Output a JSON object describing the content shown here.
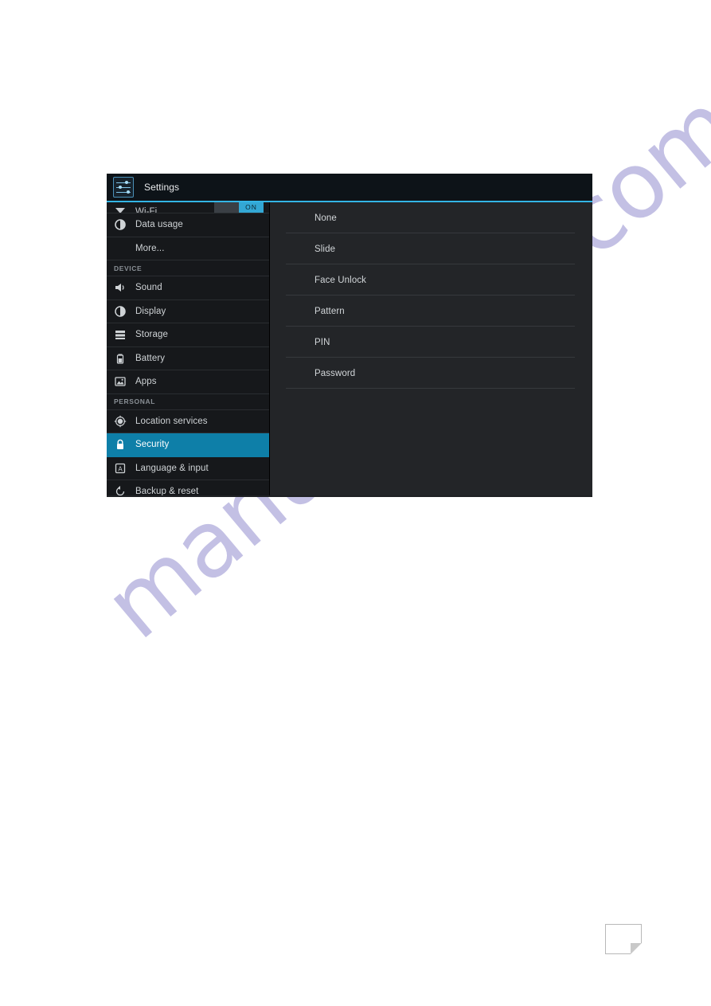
{
  "page": {
    "watermark": "manualshive.com",
    "curl_icon": "page-curl-icon"
  },
  "screenshot": {
    "actionbar": {
      "app_icon": "settings-icon",
      "title": "Settings"
    },
    "accent_color": "#33b5e5",
    "selected_color": "#0e7fa8",
    "sidebar": {
      "wifi": {
        "label": "Wi-Fi",
        "icon": "wifi-icon",
        "toggle_on_label": "ON",
        "toggle_state": "on"
      },
      "top_items": [
        {
          "label": "Data usage",
          "icon": "data-usage-icon",
          "has_icon": true
        },
        {
          "label": "More...",
          "icon": "",
          "has_icon": false
        }
      ],
      "sections": [
        {
          "header": "DEVICE",
          "items": [
            {
              "label": "Sound",
              "icon": "sound-icon",
              "selected": false
            },
            {
              "label": "Display",
              "icon": "display-icon",
              "selected": false
            },
            {
              "label": "Storage",
              "icon": "storage-icon",
              "selected": false
            },
            {
              "label": "Battery",
              "icon": "battery-icon",
              "selected": false
            },
            {
              "label": "Apps",
              "icon": "apps-icon",
              "selected": false
            }
          ]
        },
        {
          "header": "PERSONAL",
          "items": [
            {
              "label": "Location services",
              "icon": "location-icon",
              "selected": false
            },
            {
              "label": "Security",
              "icon": "lock-icon",
              "selected": true
            },
            {
              "label": "Language & input",
              "icon": "language-icon",
              "selected": false
            },
            {
              "label": "Backup & reset",
              "icon": "backup-reset-icon",
              "selected": false
            }
          ]
        }
      ]
    },
    "content": {
      "screen_lock_options": [
        {
          "label": "None"
        },
        {
          "label": "Slide"
        },
        {
          "label": "Face Unlock"
        },
        {
          "label": "Pattern"
        },
        {
          "label": "PIN"
        },
        {
          "label": "Password"
        }
      ]
    }
  }
}
